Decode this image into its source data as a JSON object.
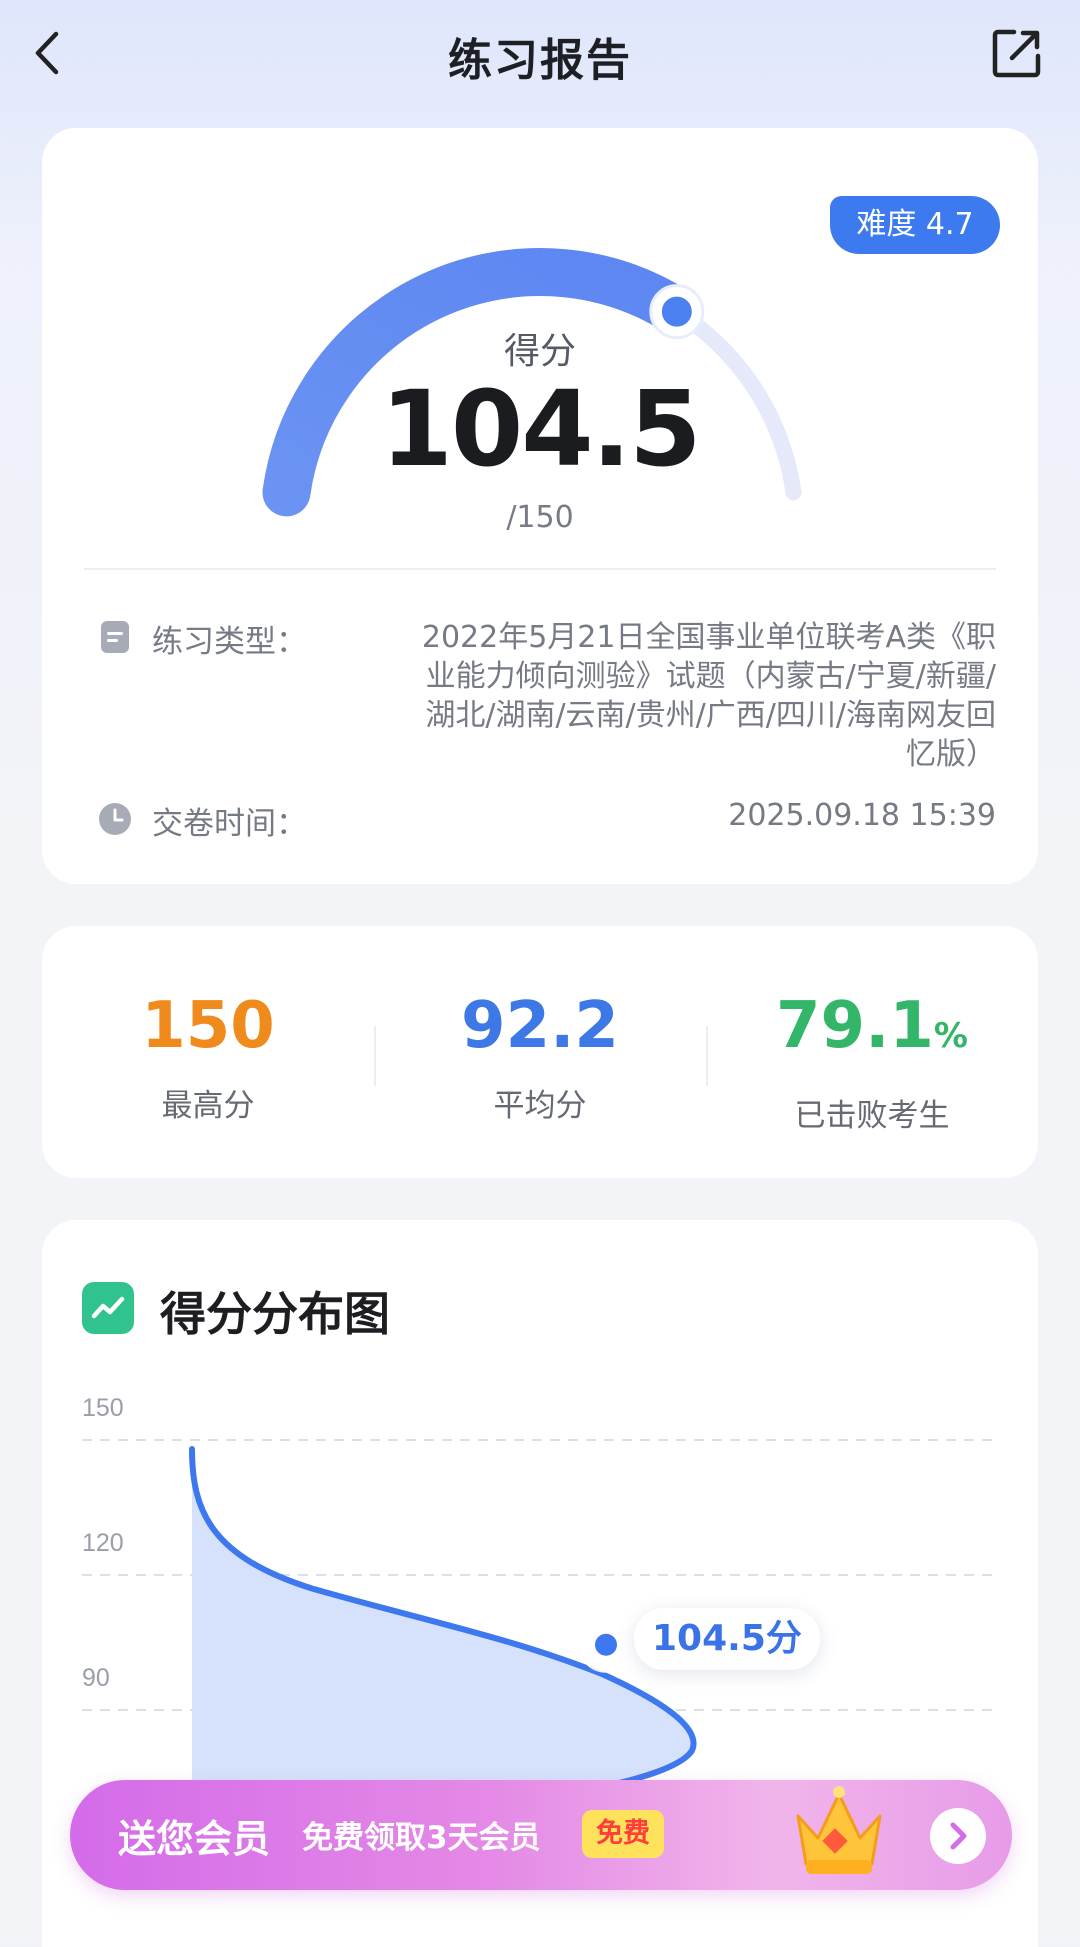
{
  "header": {
    "title": "练习报告",
    "back_icon": "back-chevron-icon",
    "share_icon": "share-icon"
  },
  "score_card": {
    "difficulty": "难度 4.7",
    "score_label": "得分",
    "score": "104.5",
    "total": "/150",
    "score_fraction": 0.697,
    "type_label": "练习类型：",
    "type_value": "2022年5月21日全国事业单位联考A类《职业能力倾向测验》试题（内蒙古/宁夏/新疆/湖北/湖南/云南/贵州/广西/四川/海南网友回忆版）",
    "time_label": "交卷时间：",
    "time_value": "2025.09.18 15:39"
  },
  "stats": [
    {
      "value": "150",
      "unit": "",
      "label": "最高分",
      "color": "#f08a1c"
    },
    {
      "value": "92.2",
      "unit": "",
      "label": "平均分",
      "color": "#3d78e6"
    },
    {
      "value": "79.1",
      "unit": "%",
      "label": "已击败考生",
      "color": "#34b66a"
    }
  ],
  "chart_card": {
    "title": "得分分布图",
    "point_label": "104.5分"
  },
  "chart_data": {
    "type": "area",
    "title": "得分分布图",
    "y_ticks": [
      "150",
      "120",
      "90"
    ],
    "ylim": [
      60,
      150
    ],
    "grid": true,
    "marker": {
      "y": 104.5,
      "label": "104.5分"
    }
  },
  "promo": {
    "main": "送您会员",
    "sub": "免费领取3天会员",
    "badge": "免费",
    "crown_icon": "crown-icon",
    "arrow_icon": "chevron-right-icon"
  },
  "colors": {
    "accent": "#3d7af0",
    "gauge_track": "#e9ecfb",
    "area_fill": "#d6e2fb"
  }
}
